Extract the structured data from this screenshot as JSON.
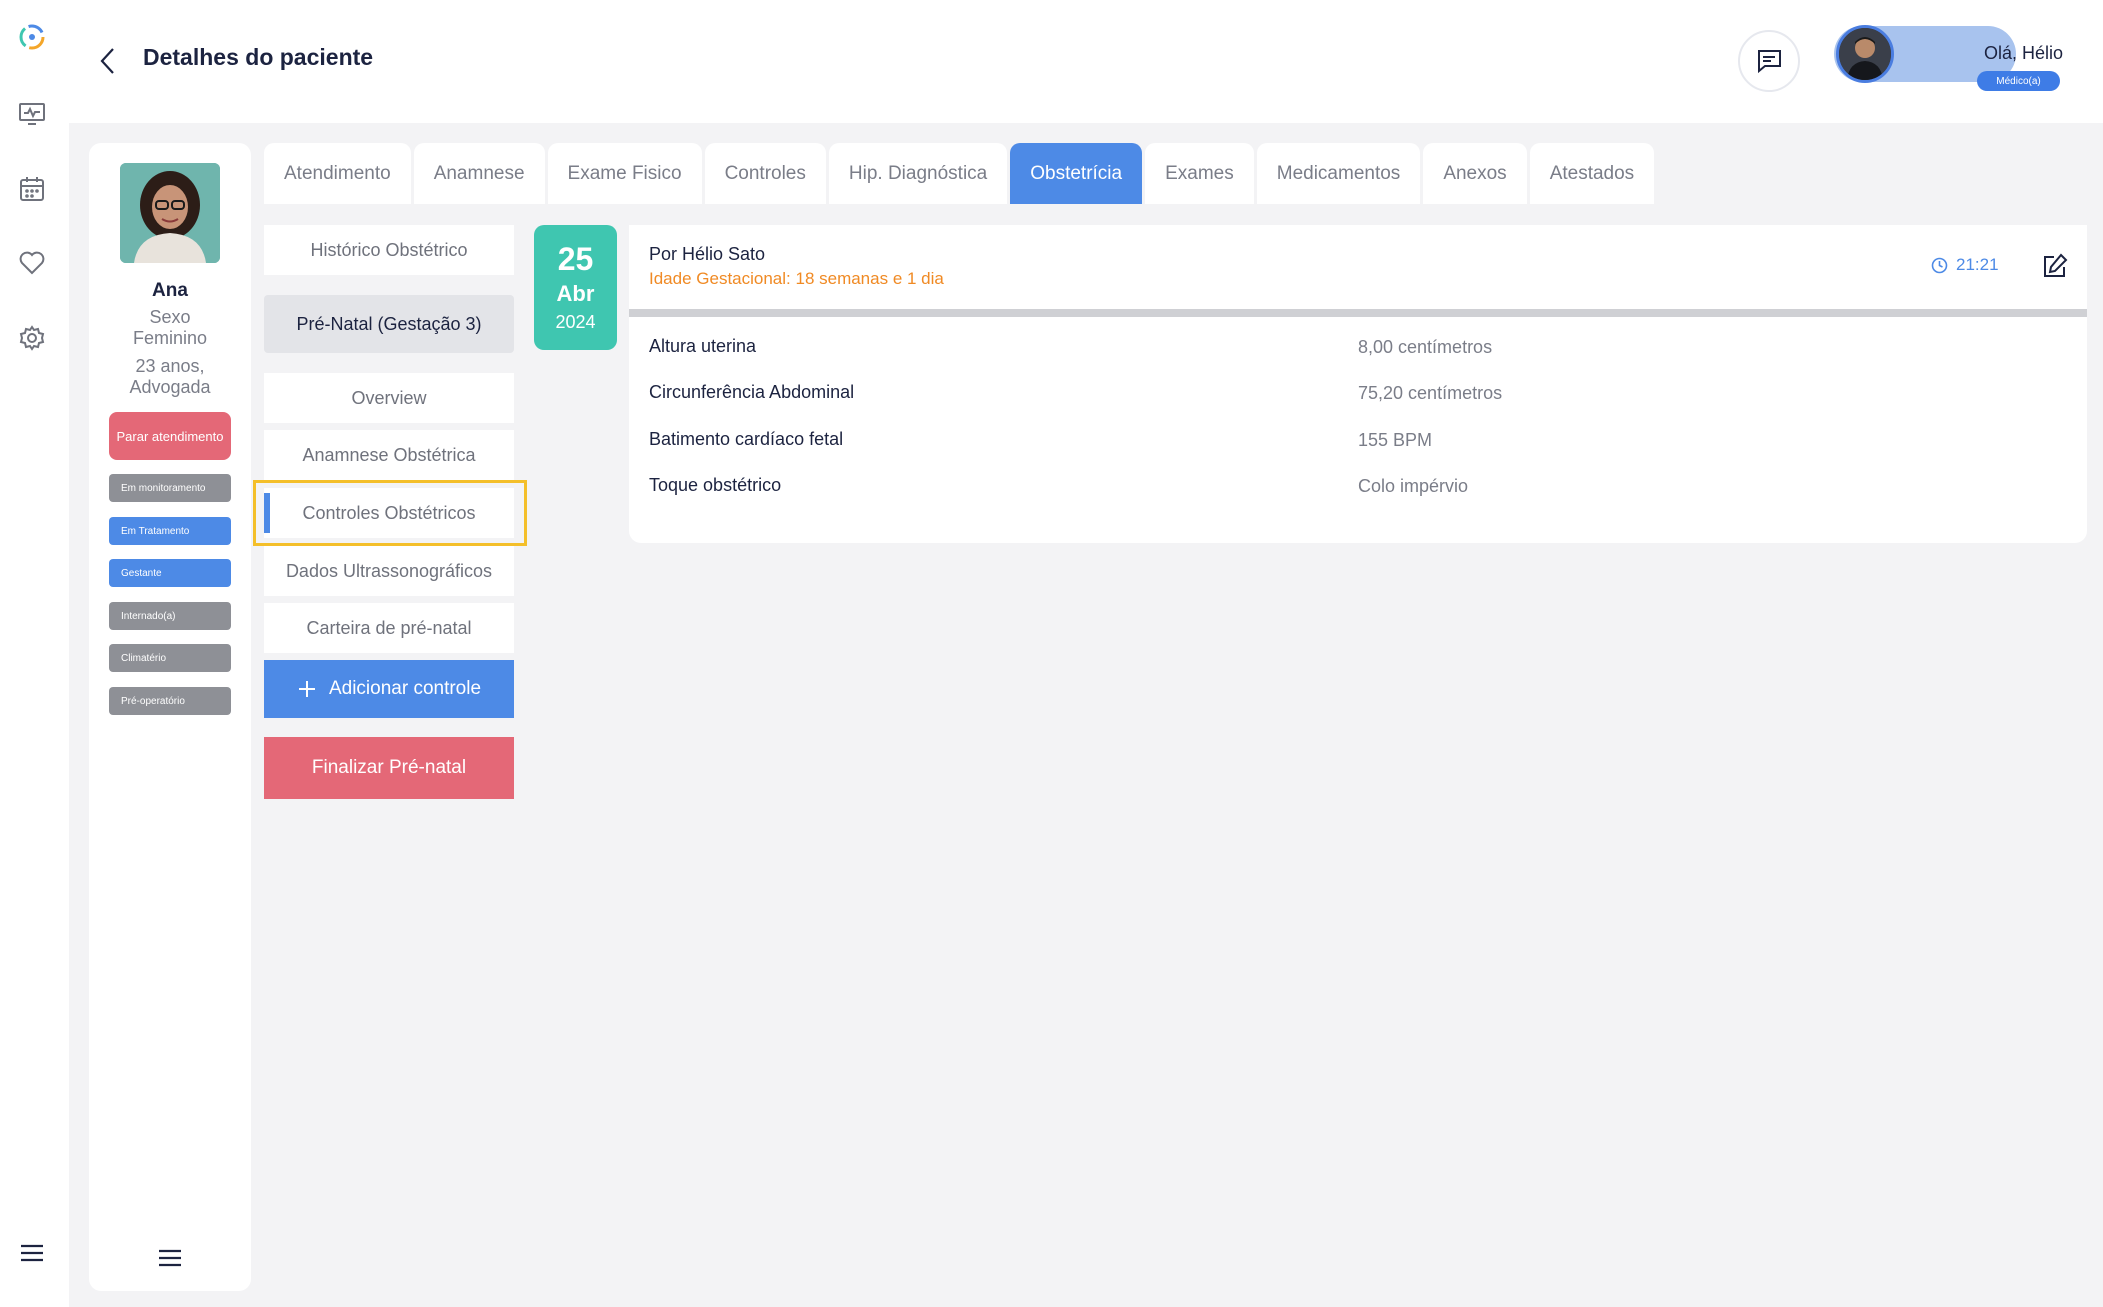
{
  "header": {
    "title": "Detalhes do paciente",
    "greeting": "Olá, Hélio",
    "role": "Médico(a)"
  },
  "rail": {
    "icons": [
      "logo-icon",
      "monitor-icon",
      "calendar-icon",
      "heart-icon",
      "settings-icon",
      "menu-icon"
    ]
  },
  "patient": {
    "name": "Ana",
    "sex_line1": "Sexo",
    "sex_line2": "Feminino",
    "age_line1": "23 anos,",
    "age_line2": "Advogada",
    "stop_button": "Parar atendimento",
    "tags": [
      {
        "label": "Em monitoramento",
        "color": "#8e9096"
      },
      {
        "label": "Em Tratamento",
        "color": "#4d8ae6"
      },
      {
        "label": "Gestante",
        "color": "#4d8ae6"
      },
      {
        "label": "Internado(a)",
        "color": "#8e9096"
      },
      {
        "label": "Climatério",
        "color": "#8e9096"
      },
      {
        "label": "Pré-operatório",
        "color": "#8e9096"
      }
    ]
  },
  "tabs": [
    {
      "label": "Atendimento",
      "active": false
    },
    {
      "label": "Anamnese",
      "active": false
    },
    {
      "label": "Exame Fisico",
      "active": false
    },
    {
      "label": "Controles",
      "active": false
    },
    {
      "label": "Hip. Diagnóstica",
      "active": false
    },
    {
      "label": "Obstetrícia",
      "active": true
    },
    {
      "label": "Exames",
      "active": false
    },
    {
      "label": "Medicamentos",
      "active": false
    },
    {
      "label": "Anexos",
      "active": false
    },
    {
      "label": "Atestados",
      "active": false
    }
  ],
  "submenu": {
    "historico": "Histórico Obstétrico",
    "prenatal": "Pré-Natal (Gestação 3)",
    "overview": "Overview",
    "anamnese": "Anamnese Obstétrica",
    "controles": "Controles Obstétricos",
    "ultrasson": "Dados Ultrassonográficos",
    "carteira": "Carteira de pré-natal",
    "add_button": "Adicionar controle",
    "finish_button": "Finalizar Pré-natal"
  },
  "record": {
    "date_day": "25",
    "date_month": "Abr",
    "date_year": "2024",
    "author": "Por Hélio Sato",
    "gestational_age": "Idade Gestacional: 18 semanas e 1 dia",
    "time": "21:21",
    "rows": [
      {
        "label": "Altura uterina",
        "value": "8,00 centímetros"
      },
      {
        "label": "Circunferência Abdominal",
        "value": "75,20 centímetros"
      },
      {
        "label": "Batimento cardíaco fetal",
        "value": "155 BPM"
      },
      {
        "label": "Toque obstétrico",
        "value": "Colo impérvio"
      }
    ]
  },
  "colors": {
    "accent": "#4d8ae6",
    "danger": "#e46877",
    "teal": "#3fc6b0",
    "orange": "#f08a24",
    "highlight": "#f4bf2a"
  }
}
